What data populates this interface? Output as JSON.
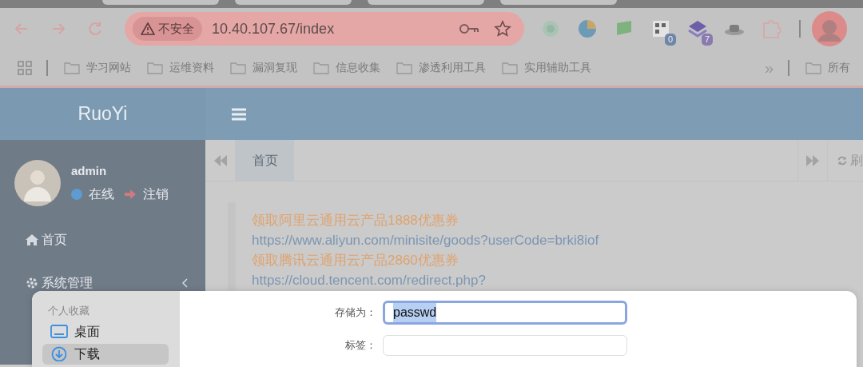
{
  "browser": {
    "security_chip": "不安全",
    "url": "10.40.107.67/index",
    "extensions": [
      {
        "kind": "circle"
      },
      {
        "kind": "pie"
      },
      {
        "kind": "flag"
      },
      {
        "kind": "grid",
        "badge": "0"
      },
      {
        "kind": "stack",
        "badge": "7"
      },
      {
        "kind": "hat"
      },
      {
        "kind": "puzzle"
      }
    ],
    "bookmarks": [
      "学习网站",
      "运维资料",
      "漏洞复现",
      "信息收集",
      "渗透利用工具",
      "实用辅助工具"
    ],
    "overflow": "»",
    "all_bookmarks": "所有"
  },
  "app": {
    "logo": "RuoYi",
    "user": {
      "name": "admin",
      "status": "在线",
      "logout": "注销"
    },
    "menu": [
      {
        "label": "首页",
        "kind": "home"
      },
      {
        "label": "系统管理",
        "kind": "submenu"
      }
    ],
    "tabs": [
      {
        "label": "首页",
        "selected": true
      }
    ],
    "refresh": "刷",
    "notice": [
      {
        "kind": "promo",
        "text": "领取阿里云通用云产品1888优惠券"
      },
      {
        "kind": "link",
        "text": "https://www.aliyun.com/minisite/goods?userCode=brki8iof"
      },
      {
        "kind": "promo",
        "text": "领取腾讯云通用云产品2860优惠券"
      },
      {
        "kind": "link",
        "text": "https://cloud.tencent.com/redirect.php?"
      }
    ]
  },
  "save_dialog": {
    "favorites_heading": "个人收藏",
    "locations": [
      {
        "label": "桌面",
        "kind": "desktop",
        "selected": false
      },
      {
        "label": "下载",
        "kind": "download",
        "selected": true
      }
    ],
    "save_as_label": "存储为：",
    "save_as_value": "passwd",
    "tags_label": "标签："
  }
}
